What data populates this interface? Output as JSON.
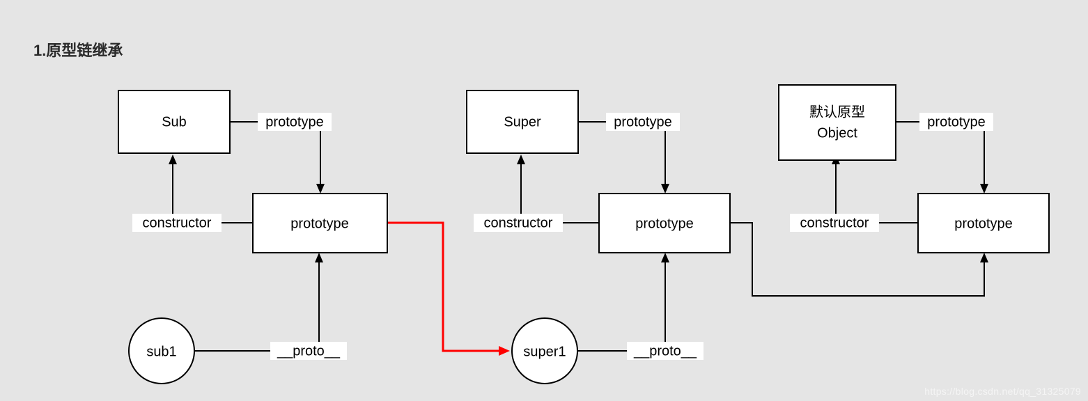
{
  "title": "1.原型链继承",
  "nodes": {
    "sub": {
      "label": "Sub"
    },
    "super": {
      "label": "Super"
    },
    "object": {
      "line1": "默认原型",
      "line2": "Object"
    },
    "proto_sub": {
      "label": "prototype"
    },
    "proto_super": {
      "label": "prototype"
    },
    "proto_obj": {
      "label": "prototype"
    },
    "sub1": {
      "label": "sub1"
    },
    "super1": {
      "label": "super1"
    }
  },
  "edges": {
    "sub_to_proto": "prototype",
    "super_to_proto": "prototype",
    "object_to_proto": "prototype",
    "protoSub_to_sub": "constructor",
    "protoSuper_to_super": "constructor",
    "protoObj_to_object": "constructor",
    "sub1_to_protoSub": "__proto__",
    "super1_to_protoSuper": "__proto__"
  },
  "watermark": "https://blog.csdn.net/qq_31325079"
}
